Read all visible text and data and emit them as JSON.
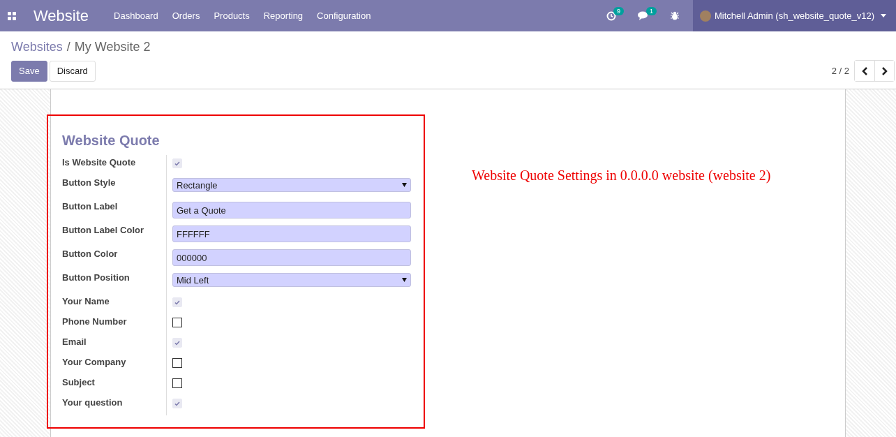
{
  "navbar": {
    "app_title": "Website",
    "menu": [
      "Dashboard",
      "Orders",
      "Products",
      "Reporting",
      "Configuration"
    ],
    "activity_count": "9",
    "message_count": "1",
    "user": "Mitchell Admin (sh_website_quote_v12)"
  },
  "breadcrumb": {
    "parent": "Websites",
    "separator": "/",
    "current": "My Website 2"
  },
  "buttons": [
    "Save",
    "Discard"
  ],
  "pager": "2 / 2",
  "form": {
    "title": "Website Quote",
    "fields": [
      {
        "label": "Is Website Quote",
        "kind": "checkbox",
        "checked": true
      },
      {
        "label": "Button Style",
        "kind": "select",
        "value": "Rectangle"
      },
      {
        "label": "Button Label",
        "kind": "text",
        "value": "Get a Quote"
      },
      {
        "label": "Button Label Color",
        "kind": "text",
        "value": "FFFFFF"
      },
      {
        "label": "Button Color",
        "kind": "text",
        "value": "000000"
      },
      {
        "label": "Button Position",
        "kind": "select",
        "value": "Mid Left"
      },
      {
        "label": "Your Name",
        "kind": "checkbox",
        "checked": true
      },
      {
        "label": "Phone Number",
        "kind": "checkbox",
        "checked": false
      },
      {
        "label": "Email",
        "kind": "checkbox",
        "checked": true
      },
      {
        "label": "Your Company",
        "kind": "checkbox",
        "checked": false
      },
      {
        "label": "Subject",
        "kind": "checkbox",
        "checked": false
      },
      {
        "label": "Your question",
        "kind": "checkbox",
        "checked": true
      }
    ]
  },
  "annotation": "Website Quote Settings in 0.0.0.0 website (website 2)"
}
